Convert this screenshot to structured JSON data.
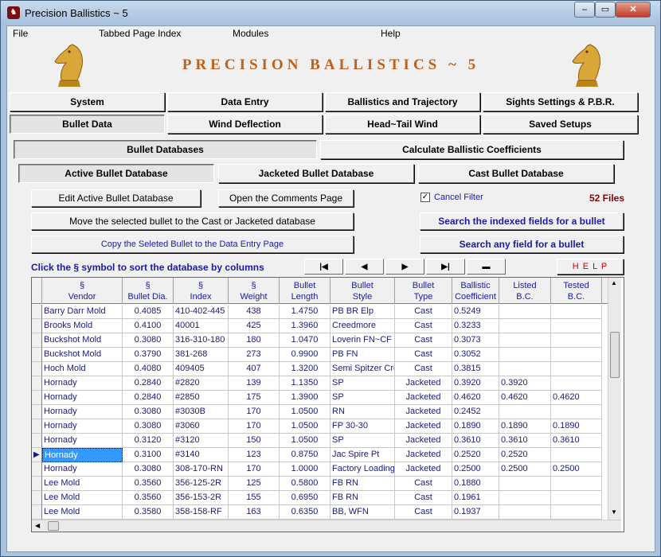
{
  "window": {
    "title": "Precision Ballistics ~ 5",
    "controls": {
      "minimize": "–",
      "maximize": "▭",
      "close": "✕"
    }
  },
  "menu": [
    "File",
    "Tabbed Page Index",
    "Modules",
    "Help"
  ],
  "header": {
    "title": "PRECISION BALLISTICS ~ 5"
  },
  "tabs_row1": [
    "System",
    "Data Entry",
    "Ballistics and Trajectory",
    "Sights Settings & P.B.R."
  ],
  "tabs_row2": [
    "Bullet Data",
    "Wind Deflection",
    "Head~Tail Wind",
    "Saved Setups"
  ],
  "subtabs": [
    "Bullet Databases",
    "Calculate Ballistic Coefficients"
  ],
  "dbtabs": [
    "Active Bullet Database",
    "Jacketed Bullet Database",
    "Cast Bullet Database"
  ],
  "actions": {
    "edit_active": "Edit Active Bullet Database",
    "open_comments": "Open the Comments Page",
    "move_selected": "Move the selected bullet to the  Cast or Jacketed database",
    "copy_selected": "Copy the Seleted Bullet to the Data Entry Page",
    "search_indexed": "Search the indexed fields for a  bullet",
    "search_any": "Search any field for a  bullet",
    "help": "H E L P"
  },
  "filter": {
    "label": "Cancel Filter",
    "checkmark": "✓",
    "files_count": "52 Files"
  },
  "sort_hint": "Click the  §  symbol to sort the database by  columns",
  "nav": {
    "first": "|◀",
    "prev": "◀",
    "next": "▶",
    "last": "▶|",
    "delete": "▬"
  },
  "grid": {
    "current_marker": "▶",
    "columns": [
      "§\nVendor",
      "§\nBullet Dia.",
      "§\nIndex",
      "§\nWeight",
      "Bullet\nLength",
      "Bullet\nStyle",
      "Bullet\nType",
      "Ballistic\nCoefficient",
      "Listed\nB.C.",
      "Tested\nB.C."
    ],
    "rows": [
      [
        "Barry Darr Mold",
        "0.4085",
        "410-402-445",
        "438",
        "1.4750",
        "PB BR Elp",
        "Cast",
        "0.5249",
        "",
        ""
      ],
      [
        "Brooks Mold",
        "0.4100",
        "40001",
        "425",
        "1.3960",
        "Creedmore",
        "Cast",
        "0.3233",
        "",
        ""
      ],
      [
        "Buckshot Mold",
        "0.3080",
        "316-310-180",
        "180",
        "1.0470",
        "Loverin FN~CF",
        "Cast",
        "0.3073",
        "",
        ""
      ],
      [
        "Buckshot Mold",
        "0.3790",
        "381-268",
        "273",
        "0.9900",
        "PB FN",
        "Cast",
        "0.3052",
        "",
        ""
      ],
      [
        "Hoch Mold",
        "0.4080",
        "409405",
        "407",
        "1.3200",
        "Semi Spitzer Cre",
        "Cast",
        "0.3815",
        "",
        ""
      ],
      [
        "Hornady",
        "0.2840",
        "#2820",
        "139",
        "1.1350",
        "SP",
        "Jacketed",
        "0.3920",
        "0.3920",
        ""
      ],
      [
        "Hornady",
        "0.2840",
        "#2850",
        "175",
        "1.3900",
        "SP",
        "Jacketed",
        "0.4620",
        "0.4620",
        "0.4620"
      ],
      [
        "Hornady",
        "0.3080",
        "#3030B",
        "170",
        "1.0500",
        "RN",
        "Jacketed",
        "0.2452",
        "",
        ""
      ],
      [
        "Hornady",
        "0.3080",
        "#3060",
        "170",
        "1.0500",
        "FP 30-30",
        "Jacketed",
        "0.1890",
        "0.1890",
        "0.1890"
      ],
      [
        "Hornady",
        "0.3120",
        "#3120",
        "150",
        "1.0500",
        "SP",
        "Jacketed",
        "0.3610",
        "0.3610",
        "0.3610"
      ],
      [
        "Hornady",
        "0.3100",
        "#3140",
        "123",
        "0.8750",
        "Jac Spire Pt",
        "Jacketed",
        "0.2520",
        "0.2520",
        ""
      ],
      [
        "Hornady",
        "0.3080",
        "308-170-RN",
        "170",
        "1.0000",
        "Factory Loading",
        "Jacketed",
        "0.2500",
        "0.2500",
        "0.2500"
      ],
      [
        "Lee Mold",
        "0.3560",
        "356-125-2R",
        "125",
        "0.5800",
        "FB RN",
        "Cast",
        "0.1880",
        "",
        ""
      ],
      [
        "Lee Mold",
        "0.3560",
        "356-153-2R",
        "155",
        "0.6950",
        "FB RN",
        "Cast",
        "0.1961",
        "",
        ""
      ],
      [
        "Lee Mold",
        "0.3580",
        "358-158-RF",
        "163",
        "0.6350",
        "BB, WFN",
        "Cast",
        "0.1937",
        "",
        ""
      ]
    ],
    "current_row": 10
  },
  "colors": {
    "accent": "#c0601a",
    "link": "#1a1aa6",
    "files": "#8b0000",
    "help": "#cc0000",
    "selection": "#3399ff"
  }
}
